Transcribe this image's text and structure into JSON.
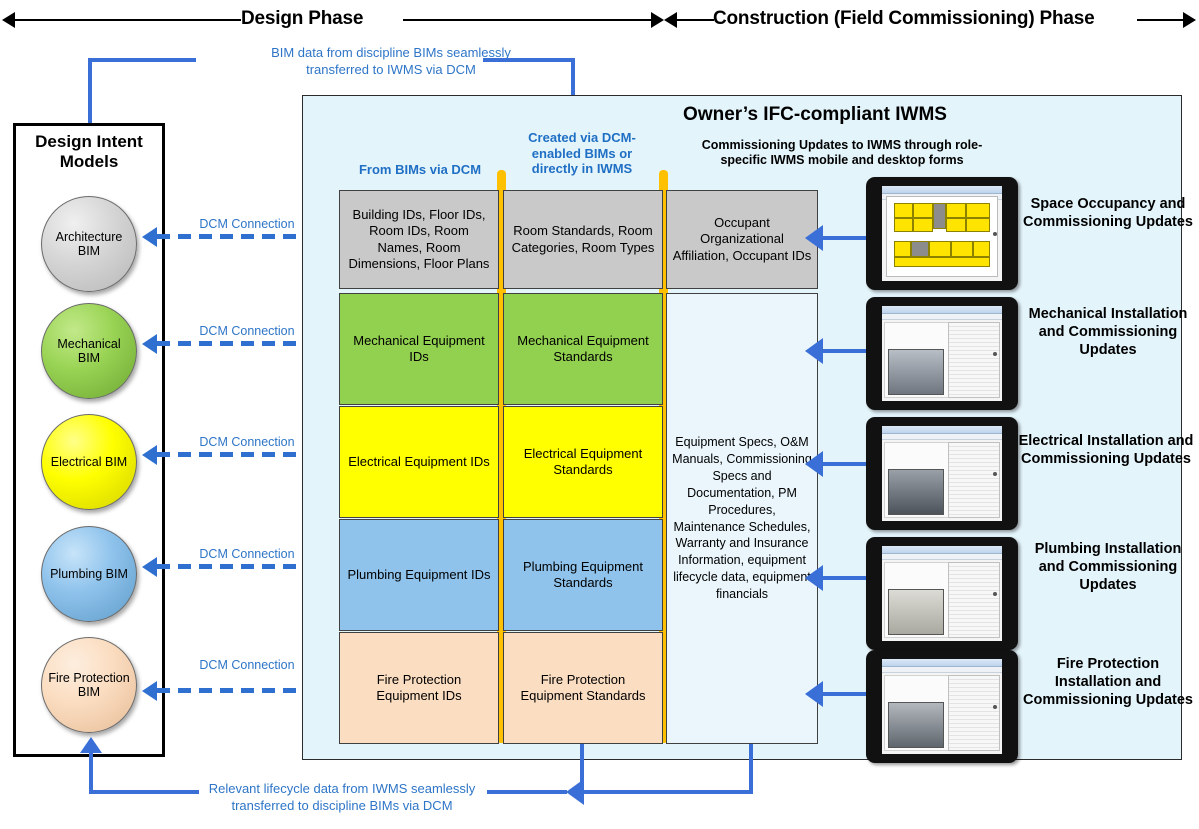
{
  "header": {
    "design_phase": "Design Phase",
    "construction_phase": "Construction (Field Commissioning) Phase"
  },
  "top_flow": {
    "line1": "BIM data from discipline BIMs seamlessly",
    "line2": "transferred to IWMS via DCM"
  },
  "bottom_flow": {
    "line1": "Relevant lifecycle data from IWMS seamlessly",
    "line2": "transferred to discipline BIMs via DCM"
  },
  "design_intent": {
    "title_line1": "Design Intent",
    "title_line2": "Models",
    "models": [
      {
        "label": "Architecture BIM",
        "color": "#c9c9c9"
      },
      {
        "label": "Mechanical BIM",
        "color": "#92d050"
      },
      {
        "label": "Electrical BIM",
        "color": "#ffff00"
      },
      {
        "label": "Plumbing BIM",
        "color": "#8fc3ec"
      },
      {
        "label": "Fire Protection BIM",
        "color": "#fbddc1"
      }
    ],
    "connection_label": "DCM Connection",
    "connections": [
      "DCM Connection",
      "DCM Connection",
      "DCM Connection",
      "DCM Connection",
      "DCM Connection"
    ]
  },
  "iwms": {
    "title": "Owner’s IFC-compliant IWMS",
    "columns": {
      "col1_header": "From BIMs via DCM",
      "col2_header_line1": "Created via DCM-",
      "col2_header_line2": "enabled BIMs or",
      "col2_header_line3": "directly in IWMS",
      "col3_header_line1": "Commissioning Updates to IWMS through role-",
      "col3_header_line2": "specific IWMS mobile and desktop forms"
    },
    "rows": [
      {
        "color": "#c9c9c9",
        "col1": "Building IDs, Floor IDs, Room IDs, Room Names, Room Dimensions, Floor Plans",
        "col2": "Room Standards, Room Categories, Room Types",
        "col3": "Occupant Organizational Affiliation, Occupant IDs"
      },
      {
        "color": "#92d050",
        "col1": "Mechanical Equipment IDs",
        "col2": "Mechanical Equipment Standards"
      },
      {
        "color": "#ffff00",
        "col1": "Electrical Equipment IDs",
        "col2": "Electrical Equipment Standards"
      },
      {
        "color": "#8fc3ec",
        "col1": "Plumbing Equipment IDs",
        "col2": "Plumbing Equipment Standards"
      },
      {
        "color": "#fbddc1",
        "col1": "Fire Protection Equipment IDs",
        "col2": "Fire Protection Equipment Standards"
      }
    ],
    "merged_col3": "Equipment Specs, O&M Manuals, Commissioning Specs and Documentation, PM Procedures, Maintenance Schedules, Warranty and Insurance Information, equipment lifecycle data, equipment financials"
  },
  "device_labels": [
    "Space Occupancy and Commissioning Updates",
    "Mechanical Installation and Commissioning Updates",
    "Electrical Installation and Commissioning Updates",
    "Plumbing Installation and Commissioning Updates",
    "Fire Protection Installation and Commissioning Updates"
  ],
  "colors": {
    "panel_bg": "#e4f4fb",
    "accent_blue": "#3a6fd8",
    "label_blue": "#2e75c7",
    "lane_yellow": "#ffc000"
  }
}
